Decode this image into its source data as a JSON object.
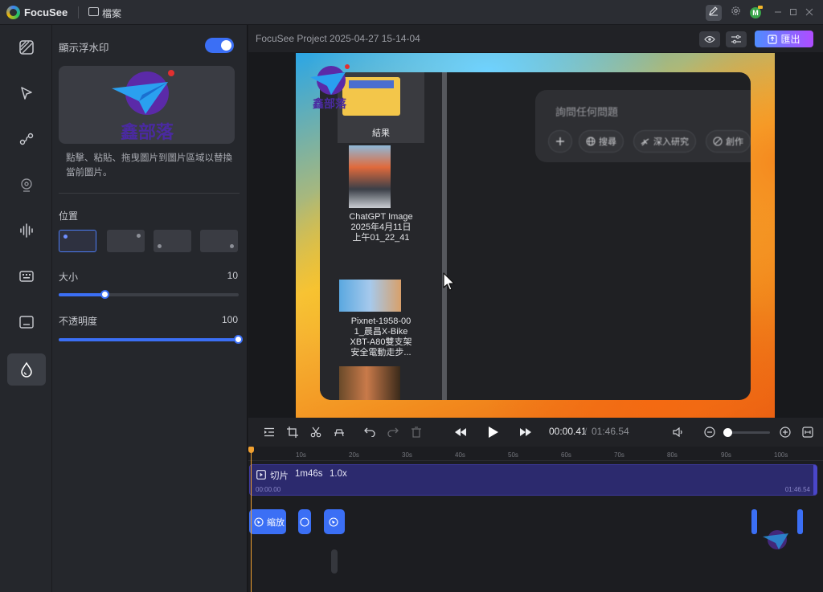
{
  "titlebar": {
    "app_name": "FocuSee",
    "file_menu": "檔案",
    "avatar_letter": "M"
  },
  "sidebar_icons": [
    "background-icon",
    "cursor-icon",
    "path-icon",
    "webcam-icon",
    "audio-icon",
    "keyboard-icon",
    "caption-icon",
    "watermark-icon"
  ],
  "panel": {
    "show_watermark_label": "顯示浮水印",
    "show_watermark_on": true,
    "watermark_text": "鑫部落",
    "hint": "點擊、粘貼、拖曳圖片到圖片區域以替換當前圖片。",
    "position_label": "位置",
    "size_label": "大小",
    "size_value": "10",
    "size_fraction": 0.26,
    "opacity_label": "不透明度",
    "opacity_value": "100",
    "opacity_fraction": 1.0
  },
  "header": {
    "project_title": "FocuSee Project 2025-04-27 15-14-04",
    "export_label": "匯出"
  },
  "preview": {
    "watermark_text": "鑫部落",
    "files": [
      {
        "caption": "結果"
      },
      {
        "caption_lines": [
          "ChatGPT Image",
          "2025年4月11日",
          "上午01_22_41"
        ]
      },
      {
        "caption_lines": [
          "Pixnet-1958-00",
          "1_晨昌X-Bike",
          "XBT-A80雙支架",
          "安全電動走步..."
        ]
      }
    ],
    "chat_placeholder": "詢問任何問題",
    "chips": [
      "搜尋",
      "深入研究",
      "創作"
    ]
  },
  "playback": {
    "current_time": "00:00.41",
    "separator": "/",
    "total_time": "01:46.54"
  },
  "timeline": {
    "ticks": [
      "10s",
      "20s",
      "30s",
      "40s",
      "50s",
      "60s",
      "70s",
      "80s",
      "90s",
      "100s"
    ],
    "clip_label": "切片",
    "clip_duration": "1m46s",
    "clip_speed": "1.0x",
    "clip_start": "00:00.00",
    "clip_end": "01:46.54",
    "zoom_label": "縮放"
  },
  "colors": {
    "accent": "#3b6ff5",
    "clip": "#2c2a6e",
    "playhead": "#f0a030"
  }
}
